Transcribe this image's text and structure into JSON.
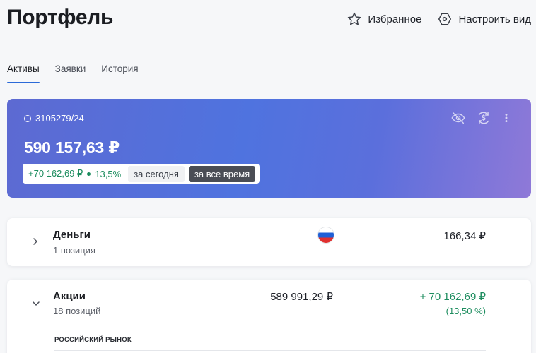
{
  "header": {
    "title": "Портфель",
    "favorites_label": "Избранное",
    "customize_label": "Настроить вид"
  },
  "tabs": [
    {
      "label": "Активы",
      "active": true
    },
    {
      "label": "Заявки",
      "active": false
    },
    {
      "label": "История",
      "active": false
    }
  ],
  "account": {
    "id": "3105279/24",
    "balance": "590 157,63 ₽",
    "change_value": "+70 162,69 ₽",
    "change_percent": "13,5%",
    "periods": [
      {
        "label": "за сегодня",
        "active": false
      },
      {
        "label": "за все время",
        "active": true
      }
    ],
    "icons": [
      "eye-off-icon",
      "currency-exchange-icon",
      "more-vertical-icon"
    ]
  },
  "assets": [
    {
      "title": "Деньги",
      "subtitle": "1 позиция",
      "amount": "166,34 ₽",
      "expanded": false,
      "flag": "russia"
    },
    {
      "title": "Акции",
      "subtitle": "18 позиций",
      "amount": "589 991,29 ₽",
      "gain": "+ 70 162,69 ₽",
      "gain_percent": "(13,50 %)",
      "expanded": true,
      "section_label": "РОССИЙСКИЙ РЫНОК"
    }
  ],
  "colors": {
    "gain_green": "#1c8c5e",
    "accent_blue": "#2b6ad8",
    "card_gradient_start": "#5d6ad2",
    "card_gradient_end": "#8f79d8"
  }
}
